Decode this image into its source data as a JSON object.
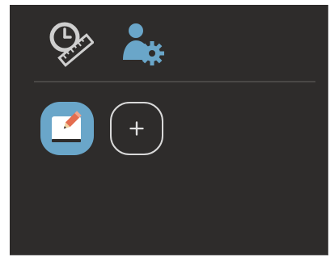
{
  "toolbar": {
    "items": [
      {
        "icon": "clock-ruler-icon"
      },
      {
        "icon": "user-gear-icon"
      }
    ]
  },
  "apps": {
    "items": [
      {
        "icon": "note-edit-icon"
      },
      {
        "icon": "plus-icon"
      }
    ]
  },
  "colors": {
    "background": "#2e2c2b",
    "accent": "#6aa6c9",
    "icon_gray": "#cfcfcf",
    "divider": "#4a4846"
  }
}
